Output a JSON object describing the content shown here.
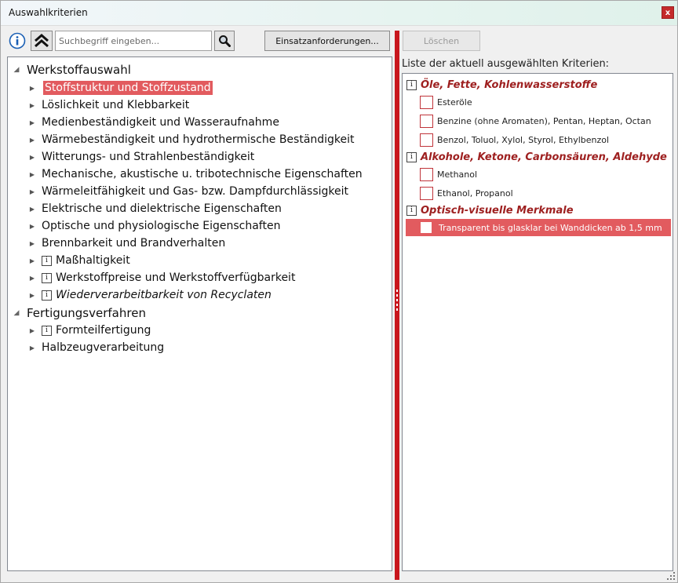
{
  "window": {
    "title": "Auswahlkriterien",
    "close_label": "x"
  },
  "toolbar": {
    "search_placeholder": "Suchbegriff eingeben...",
    "einsatz_label": "Einsatzanforderungen...",
    "loeschen_label": "Löschen"
  },
  "tree": {
    "root1": "Werkstoffauswahl",
    "items1": [
      "Stoffstruktur und Stoffzustand",
      "Löslichkeit und Klebbarkeit",
      "Medienbeständigkeit und Wasseraufnahme",
      "Wärmebeständigkeit und hydrothermische Beständigkeit",
      "Witterungs- und Strahlenbeständigkeit",
      "Mechanische, akustische u. tribotechnische Eigenschaften",
      "Wärmeleitfähigkeit und Gas- bzw. Dampfdurchlässigkeit",
      "Elektrische und dielektrische Eigenschaften",
      "Optische und physiologische Eigenschaften",
      "Brennbarkeit und Brandverhalten",
      "Maßhaltigkeit",
      "Werkstoffpreise und Werkstoffverfügbarkeit",
      "Wiederverarbeitbarkeit von Recyclaten"
    ],
    "root2": "Fertigungsverfahren",
    "items2": [
      "Formteilfertigung",
      "Halbzeugverarbeitung"
    ]
  },
  "criteria": {
    "header": "Liste der aktuell ausgewählten Kriterien:",
    "groups": [
      {
        "label": "Öle, Fette, Kohlenwasserstoffe",
        "items": [
          "Esteröle",
          "Benzine (ohne Aromaten), Pentan, Heptan, Octan",
          "Benzol, Toluol, Xylol, Styrol, Ethylbenzol"
        ]
      },
      {
        "label": "Alkohole, Ketone, Carbonsäuren, Aldehyde",
        "items": [
          "Methanol",
          "Ethanol, Propanol"
        ]
      },
      {
        "label": "Optisch-visuelle Merkmale",
        "items": [
          "Transparent bis glasklar bei Wanddicken ab 1,5 mm"
        ]
      }
    ]
  },
  "colors": {
    "accent": "#c8161d",
    "selection": "#e25b5f",
    "group_text": "#9e2020"
  },
  "icons": [
    "info-icon",
    "double-chevron-up-icon",
    "magnifier-icon",
    "info-box-icon",
    "expand-arrow-icon",
    "collapse-arrow-icon",
    "checkbox-icon",
    "resize-grip-icon"
  ]
}
